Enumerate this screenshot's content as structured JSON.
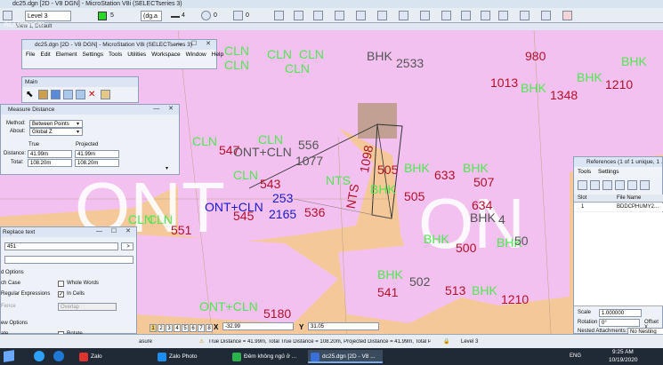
{
  "window": {
    "title": "dc25.dgn [2D - V8 DGN] - MicroStation V8i (SELECTseries 3)"
  },
  "attrbar": {
    "level": "Level 3",
    "color": "5",
    "style": "(dg.a",
    "weight": "4",
    "transparency": "0",
    "priority": "0"
  },
  "view": {
    "title": "View 1, Default",
    "watermark": "ALOnhadat"
  },
  "main_window": {
    "title": "dc25.dgn [2D - V8 DGN] - MicroStation V8i (SELECTseries 3)",
    "menus": [
      "File",
      "Edit",
      "Element",
      "Settings",
      "Tools",
      "Utilities",
      "Workspace",
      "Window",
      "Help"
    ]
  },
  "main_toolbox": {
    "title": "Main"
  },
  "measure": {
    "title": "Measure Distance",
    "method_label": "Method:",
    "method_value": "Between Points",
    "about_label": "About:",
    "about_value": "Global Z",
    "col_true": "True",
    "col_projected": "Projected",
    "distance_label": "Distance:",
    "distance_true": "41.99m",
    "distance_projected": "41.99m",
    "total_label": "Total:",
    "total_true": "108.20m",
    "total_projected": "108.20m"
  },
  "replace": {
    "title": "Replace text",
    "find_value": "451",
    "options_header": "d Options",
    "match_case": "ch Case",
    "whole_words": "Whole Words",
    "regex": "Regular Expressions",
    "in_cells": "In Cells",
    "fence_label": "Fence",
    "fence_value": "Overlap",
    "view_options": "ew Options",
    "rotate_left": "ate",
    "rotate": "Rotate"
  },
  "references": {
    "title": "References (1 of 1 unique, 1 ...",
    "menus": [
      "Tools",
      "Settings"
    ],
    "col_slot": "Slot",
    "col_file": "File Name",
    "row_slot": "1",
    "row_file": "BDDCPHUMY2...",
    "scale_label": "Scale",
    "scale_value": "1.000000",
    "rotation_label": "Rotation",
    "rotation_value": "0°",
    "offset_label": "Offset X",
    "nested_label": "Nested Attachments:",
    "nested_value": "No Nesting"
  },
  "status": {
    "x_label": "X",
    "x_value": "-32.99",
    "y_label": "Y",
    "y_value": "31.05",
    "view_buttons": [
      "1",
      "2",
      "3",
      "4",
      "5",
      "6",
      "7",
      "8"
    ],
    "left_prompt": "asure",
    "message": "True Distance = 41.99m, Total True Distance = 108.20m, Projected Distance = 41.99m, Total Pr",
    "level": "Level 3"
  },
  "taskbar": {
    "items": [
      "Zalo",
      "Zalo Photo",
      "Đêm không ngủ ở ...",
      "dc25.dgn [2D - V8 ..."
    ],
    "lang": "ENG",
    "time": "9:25 AM",
    "date": "10/19/2020"
  },
  "map_labels": [
    {
      "t": "CLN",
      "c": "g"
    },
    {
      "t": "CLN",
      "c": "g"
    },
    {
      "t": "CLN",
      "c": "g"
    },
    {
      "t": "BHK",
      "c": "d"
    },
    {
      "t": "2533",
      "c": "d"
    },
    {
      "t": "980",
      "c": "r"
    },
    {
      "t": "BHK",
      "c": "g"
    },
    {
      "t": "CLN",
      "c": "g"
    },
    {
      "t": "CLN",
      "c": "g"
    },
    {
      "t": "1013",
      "c": "r"
    },
    {
      "t": "BHK",
      "c": "g"
    },
    {
      "t": "BHK",
      "c": "g"
    },
    {
      "t": "1210",
      "c": "r"
    },
    {
      "t": "1348",
      "c": "r"
    },
    {
      "t": "CLN",
      "c": "g"
    },
    {
      "t": "CLN",
      "c": "g"
    },
    {
      "t": "556",
      "c": "d"
    },
    {
      "t": "547",
      "c": "r"
    },
    {
      "t": "ONT+CLN",
      "c": "d"
    },
    {
      "t": "1077",
      "c": "d"
    },
    {
      "t": "505",
      "c": "r"
    },
    {
      "t": "BHK",
      "c": "g"
    },
    {
      "t": "633",
      "c": "r"
    },
    {
      "t": "BHK",
      "c": "g"
    },
    {
      "t": "CLN",
      "c": "g"
    },
    {
      "t": "543",
      "c": "r"
    },
    {
      "t": "NTS",
      "c": "g"
    },
    {
      "t": "BHK",
      "c": "g"
    },
    {
      "t": "507",
      "c": "r"
    },
    {
      "t": "253",
      "c": "b"
    },
    {
      "t": "ONT+CLN",
      "c": "b"
    },
    {
      "t": "2165",
      "c": "b"
    },
    {
      "t": "545",
      "c": "r"
    },
    {
      "t": "536",
      "c": "r"
    },
    {
      "t": "505",
      "c": "r"
    },
    {
      "t": "634",
      "c": "r"
    },
    {
      "t": "BHK",
      "c": "d"
    },
    {
      "t": "CLN",
      "c": "g"
    },
    {
      "t": "CLN",
      "c": "g"
    },
    {
      "t": "551",
      "c": "r"
    },
    {
      "t": "500",
      "c": "r"
    },
    {
      "t": "BHK",
      "c": "g"
    },
    {
      "t": "BHK",
      "c": "g"
    },
    {
      "t": "BHK",
      "c": "g"
    },
    {
      "t": "541",
      "c": "r"
    },
    {
      "t": "502",
      "c": "d"
    },
    {
      "t": "513",
      "c": "r"
    },
    {
      "t": "BHK",
      "c": "g"
    },
    {
      "t": "1210",
      "c": "r"
    },
    {
      "t": "ONT+CLN",
      "c": "g"
    },
    {
      "t": "5180",
      "c": "r"
    },
    {
      "t": "NTS",
      "c": "r"
    },
    {
      "t": "1098",
      "c": "r"
    },
    {
      "t": "4",
      "c": "d"
    },
    {
      "t": "50",
      "c": "d"
    }
  ]
}
